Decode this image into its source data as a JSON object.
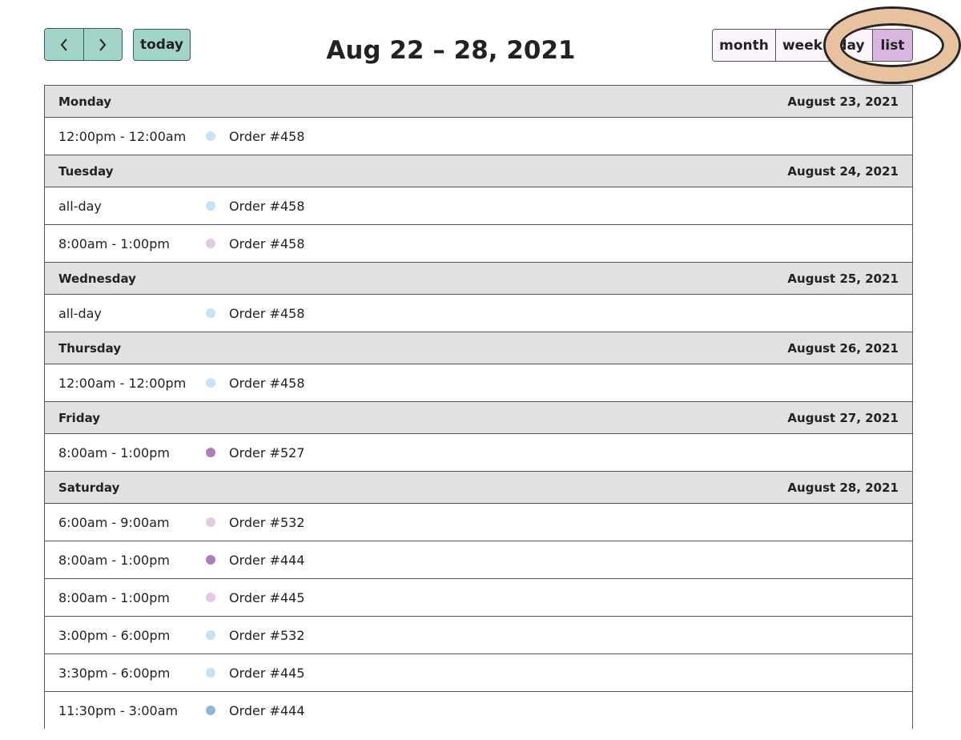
{
  "toolbar": {
    "prev_icon": "chevron-left-icon",
    "next_icon": "chevron-right-icon",
    "today_label": "today",
    "title": "Aug 22 – 28, 2021",
    "views": [
      "month",
      "week",
      "day",
      "list"
    ],
    "active_view": "list"
  },
  "colors": {
    "nav_button_bg": "#a3d4c9",
    "view_button_bg": "#fbf4fb",
    "view_button_active_bg": "#d9b6e0",
    "day_header_bg": "#e1e1e1",
    "highlight_ring": "#e8c29f",
    "dot_light_blue": "#c7e2f2",
    "dot_light_purple": "#e0cbe3",
    "dot_purple": "#ab7fb8"
  },
  "days": [
    {
      "weekday": "Monday",
      "date": "August 23, 2021",
      "events": [
        {
          "time": "12:00pm - 12:00am",
          "title": "Order #458",
          "dot_color": "#c7e2f2"
        }
      ]
    },
    {
      "weekday": "Tuesday",
      "date": "August 24, 2021",
      "events": [
        {
          "time": "all-day",
          "title": "Order #458",
          "dot_color": "#c7e2f2"
        },
        {
          "time": "8:00am - 1:00pm",
          "title": "Order #458",
          "dot_color": "#e0cbe3"
        }
      ]
    },
    {
      "weekday": "Wednesday",
      "date": "August 25, 2021",
      "events": [
        {
          "time": "all-day",
          "title": "Order #458",
          "dot_color": "#c7e2f2"
        }
      ]
    },
    {
      "weekday": "Thursday",
      "date": "August 26, 2021",
      "events": [
        {
          "time": "12:00am - 12:00pm",
          "title": "Order #458",
          "dot_color": "#c7e2f2"
        }
      ]
    },
    {
      "weekday": "Friday",
      "date": "August 27, 2021",
      "events": [
        {
          "time": "8:00am - 1:00pm",
          "title": "Order #527",
          "dot_color": "#ab7fb8"
        }
      ]
    },
    {
      "weekday": "Saturday",
      "date": "August 28, 2021",
      "events": [
        {
          "time": "6:00am - 9:00am",
          "title": "Order #532",
          "dot_color": "#e0cbe3"
        },
        {
          "time": "8:00am - 1:00pm",
          "title": "Order #444",
          "dot_color": "#ab7fb8"
        },
        {
          "time": "8:00am - 1:00pm",
          "title": "Order #445",
          "dot_color": "#e0cbe3"
        },
        {
          "time": "3:00pm - 6:00pm",
          "title": "Order #532",
          "dot_color": "#c7e2f2"
        },
        {
          "time": "3:30pm - 6:00pm",
          "title": "Order #445",
          "dot_color": "#c7e2f2"
        },
        {
          "time": "11:30pm - 3:00am",
          "title": "Order #444",
          "dot_color": "#8fb8d4"
        }
      ]
    }
  ]
}
